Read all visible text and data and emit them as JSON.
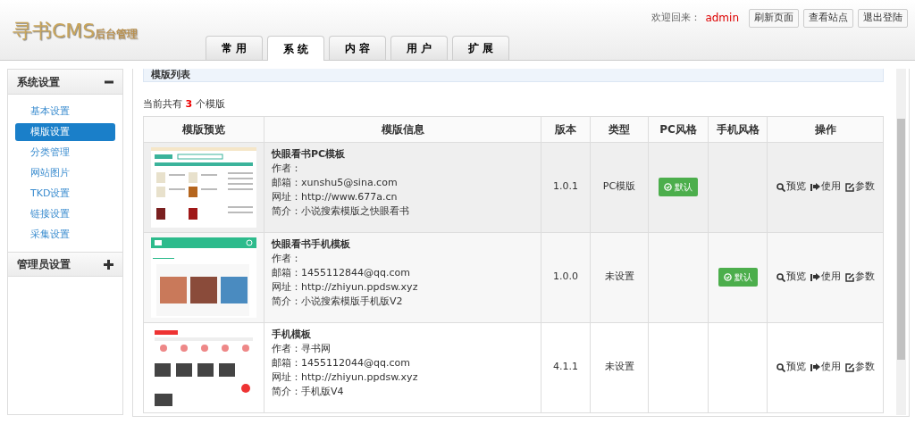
{
  "header": {
    "logo_title": "寻书CMS",
    "logo_subtitle": "后台管理",
    "welcome": "欢迎回来：",
    "user": "admin",
    "buttons": [
      "刷新页面",
      "查看站点",
      "退出登陆"
    ]
  },
  "tabs": [
    {
      "label": "常 用",
      "selected": false
    },
    {
      "label": "系 统",
      "selected": true
    },
    {
      "label": "内 容",
      "selected": false
    },
    {
      "label": "用 户",
      "selected": false
    },
    {
      "label": "扩 展",
      "selected": false
    }
  ],
  "sidebar": [
    {
      "title": "系统设置",
      "expanded": true,
      "items": [
        {
          "label": "基本设置",
          "selected": false
        },
        {
          "label": "模版设置",
          "selected": true
        },
        {
          "label": "分类管理",
          "selected": false
        },
        {
          "label": "网站图片",
          "selected": false
        },
        {
          "label": "TKD设置",
          "selected": false
        },
        {
          "label": "链接设置",
          "selected": false
        },
        {
          "label": "采集设置",
          "selected": false
        }
      ]
    },
    {
      "title": "管理员设置",
      "expanded": false
    }
  ],
  "panel": {
    "title": "模版列表",
    "count_prefix": "当前共有",
    "count": "3",
    "count_suffix": "个模版"
  },
  "table": {
    "columns": [
      "模版预览",
      "模版信息",
      "版本",
      "类型",
      "PC风格",
      "手机风格",
      "操作"
    ],
    "rows": [
      {
        "kind": "pc",
        "name": "快眼看书PC模板",
        "info": [
          "作者：",
          "邮箱：xunshu5@sina.com",
          "网址：http://www.677a.cn",
          "简介：小说搜索模版之快眼看书"
        ],
        "version": "1.0.1",
        "type": "PC模版",
        "pc_style": "默认",
        "actions": [
          {
            "kind": "preview",
            "label": "预览"
          },
          {
            "kind": "use",
            "label": "使用"
          },
          {
            "kind": "params",
            "label": "参数"
          }
        ]
      },
      {
        "kind": "mobile",
        "name": "快眼看书手机模板",
        "info": [
          "作者：",
          "邮箱：1455112844@qq.com",
          "网址：http://zhiyun.ppdsw.xyz",
          "简介：小说搜索模版手机版V2"
        ],
        "version": "1.0.0",
        "type": "未设置",
        "mobile_style": "默认",
        "actions": [
          {
            "kind": "preview",
            "label": "预览"
          },
          {
            "kind": "use",
            "label": "使用"
          },
          {
            "kind": "params",
            "label": "参数"
          }
        ]
      },
      {
        "kind": "mobile_alt",
        "name": "手机模板",
        "info": [
          "作者：寻书网",
          "邮箱：1455112044@qq.com",
          "网址：http://zhiyun.ppdsw.xyz",
          "简介：手机版V4"
        ],
        "version": "4.1.1",
        "type": "未设置",
        "actions": [
          {
            "kind": "preview",
            "label": "预览"
          },
          {
            "kind": "use",
            "label": "使用"
          },
          {
            "kind": "params",
            "label": "参数"
          }
        ]
      }
    ]
  }
}
